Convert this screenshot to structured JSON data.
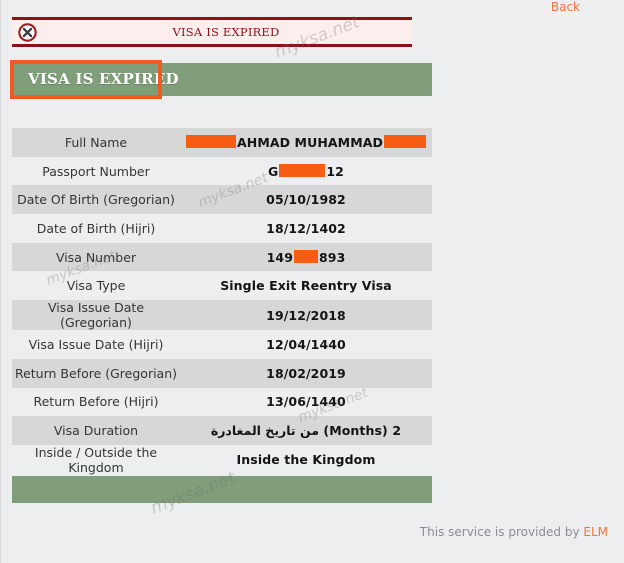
{
  "page": {
    "background_color": "#edeef0",
    "watermark_text": "myksa.net"
  },
  "alert": {
    "icon": "error-circle-x-icon",
    "message": "VISA IS EXPIRED",
    "border_color": "#8b1117",
    "background_color": "#fdeeee",
    "text_color": "#8b1117"
  },
  "header": {
    "title": "VISA IS EXPIRED",
    "bar_color": "#809e79",
    "title_color": "#ffffff",
    "highlight_color": "#f15a22"
  },
  "details": {
    "rows": [
      {
        "label": "Full Name",
        "value_prefix": "",
        "value_middle": "AHMAD MUHAMMAD",
        "value_suffix": "",
        "redacted": "leading-trailing",
        "striped": true
      },
      {
        "label": "Passport Number",
        "value_prefix": "G",
        "value_middle": "",
        "value_suffix": "12",
        "redacted": "middle",
        "striped": false
      },
      {
        "label": "Date Of Birth (Gregorian)",
        "value": "05/10/1982",
        "striped": true
      },
      {
        "label": "Date of Birth (Hijri)",
        "value": "18/12/1402",
        "striped": false
      },
      {
        "label": "Visa Number",
        "value_prefix": "149",
        "value_middle": "",
        "value_suffix": "893",
        "redacted": "middle",
        "striped": true
      },
      {
        "label": "Visa Type",
        "value": "Single Exit Reentry Visa",
        "striped": false
      },
      {
        "label": "Visa Issue Date (Gregorian)",
        "value": "19/12/2018",
        "striped": true
      },
      {
        "label": "Visa Issue Date (Hijri)",
        "value": "12/04/1440",
        "striped": false
      },
      {
        "label": "Return Before (Gregorian)",
        "value": "18/02/2019",
        "striped": true
      },
      {
        "label": "Return Before (Hijri)",
        "value": "13/06/1440",
        "striped": false
      },
      {
        "label": "Visa Duration",
        "value": "2 (Months) من تاريخ المغادرة",
        "striped": true
      },
      {
        "label": "Inside / Outside the Kingdom",
        "value": "Inside the Kingdom",
        "striped": false
      }
    ],
    "redaction_color": "#f75c13",
    "stripe_color": "#d6d7d9"
  },
  "footer": {
    "service_text": "This service is provided by ",
    "provider": "ELM",
    "back_label": "Back",
    "link_color": "#f1753b",
    "text_color": "#8a8e93",
    "bar_color": "#809e79"
  }
}
